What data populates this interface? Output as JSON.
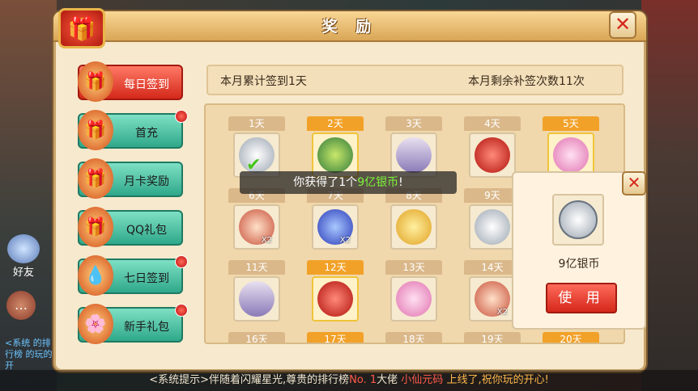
{
  "dialog": {
    "title": "奖 励"
  },
  "sidebar": {
    "items": [
      {
        "label": "每日签到",
        "active": true,
        "badge": false
      },
      {
        "label": "首充",
        "active": false,
        "badge": true
      },
      {
        "label": "月卡奖励",
        "active": false,
        "badge": false
      },
      {
        "label": "QQ礼包",
        "active": false,
        "badge": false
      },
      {
        "label": "七日签到",
        "active": false,
        "badge": true
      },
      {
        "label": "新手礼包",
        "active": false,
        "badge": true
      }
    ]
  },
  "signin": {
    "cumulative": "本月累计签到1天",
    "remaining": "本月剩余补签次数11次"
  },
  "days": [
    {
      "label": "1天",
      "gold": false,
      "item": "silver-coin",
      "qty": "",
      "checked": true
    },
    {
      "label": "2天",
      "gold": true,
      "item": "jade-pendant",
      "qty": "",
      "checked": false
    },
    {
      "label": "3天",
      "gold": false,
      "item": "scroll",
      "qty": "",
      "checked": false
    },
    {
      "label": "4天",
      "gold": false,
      "item": "red-gem",
      "qty": "",
      "checked": false
    },
    {
      "label": "5天",
      "gold": true,
      "item": "pink-egg",
      "qty": "",
      "checked": false
    },
    {
      "label": "6天",
      "gold": false,
      "item": "pet-bag",
      "qty": "X2",
      "checked": false
    },
    {
      "label": "7天",
      "gold": false,
      "item": "blue-orb",
      "qty": "X2",
      "checked": false
    },
    {
      "label": "8天",
      "gold": false,
      "item": "gold-coin",
      "qty": "",
      "checked": false
    },
    {
      "label": "9天",
      "gold": false,
      "item": "silver-coin",
      "qty": "",
      "checked": false
    },
    {
      "label": "11天",
      "gold": false,
      "item": "scroll",
      "qty": "",
      "checked": false
    },
    {
      "label": "12天",
      "gold": true,
      "item": "red-gem",
      "qty": "",
      "checked": false
    },
    {
      "label": "13天",
      "gold": false,
      "item": "pink-egg",
      "qty": "",
      "checked": false
    },
    {
      "label": "14天",
      "gold": false,
      "item": "pet-bag",
      "qty": "X2",
      "checked": false
    },
    {
      "label": "16天",
      "gold": false,
      "item": "",
      "qty": "",
      "checked": false
    },
    {
      "label": "17天",
      "gold": true,
      "item": "",
      "qty": "",
      "checked": false
    },
    {
      "label": "18天",
      "gold": false,
      "item": "",
      "qty": "",
      "checked": false
    },
    {
      "label": "19天",
      "gold": false,
      "item": "",
      "qty": "",
      "checked": false
    },
    {
      "label": "20天",
      "gold": true,
      "item": "",
      "qty": "",
      "checked": false
    }
  ],
  "toast": {
    "prefix": "你获得了1个",
    "highlight": "9亿银币",
    "suffix": "!"
  },
  "popup": {
    "item_name": "9亿银币",
    "use_label": "使 用"
  },
  "hud": {
    "friend_label": "好友",
    "side_log": "<系统 的排行榜 的玩的开"
  },
  "ticker": {
    "part1": "<系统提示>伴随着闪耀星光,尊贵的排行榜",
    "rank": "No. 1",
    "part2": "大佬",
    "name": "小仙元码",
    "part3": "上线了,祝你玩的开心!"
  },
  "icons": {
    "gift": "gift-icon",
    "close": "close-icon",
    "silver-coin": "silver-coin-icon",
    "jade-pendant": "jade-pendant-icon",
    "scroll": "scroll-icon",
    "red-gem": "red-gem-icon",
    "pink-egg": "pink-egg-icon",
    "pet-bag": "pet-bag-icon",
    "blue-orb": "blue-orb-icon",
    "gold-coin": "gold-coin-icon"
  },
  "colors": {
    "accent": "#d4281a",
    "gold_header": "#f2a128",
    "toast_highlight": "#7ef53a"
  }
}
